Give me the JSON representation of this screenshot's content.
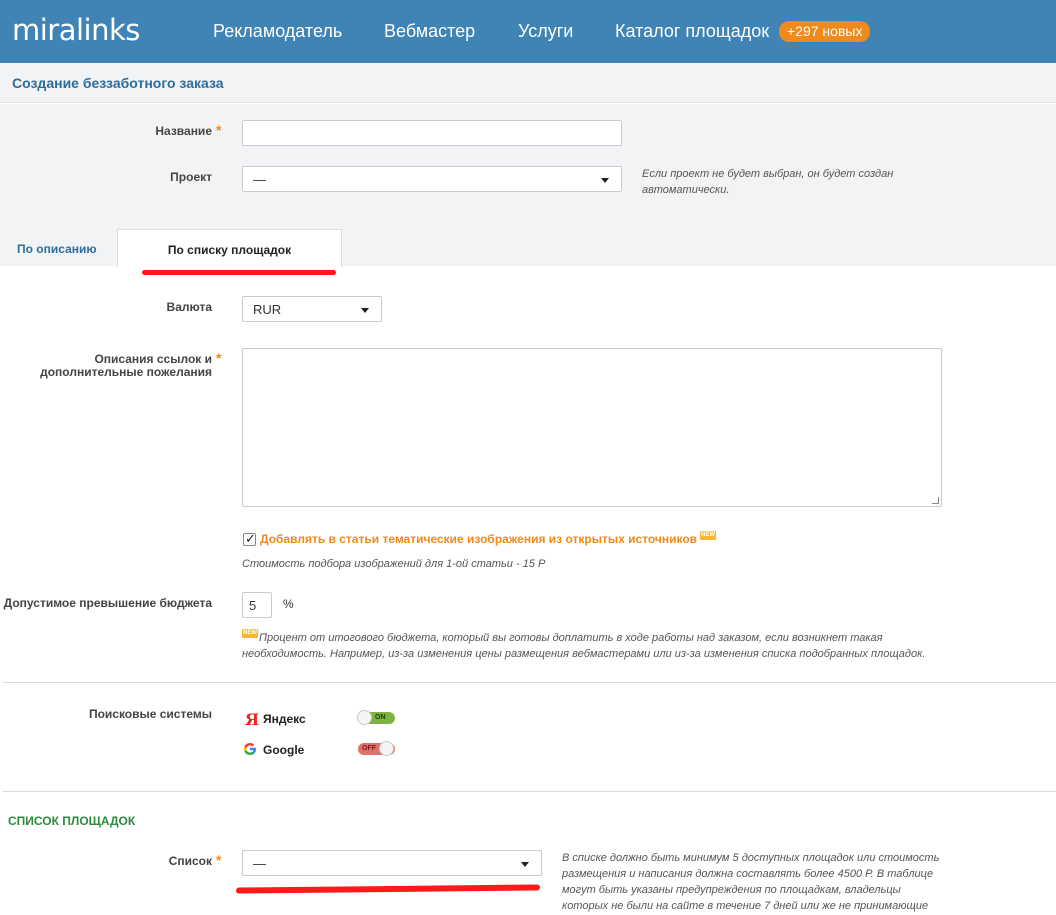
{
  "header": {
    "logo": "miralinks",
    "nav": [
      "Рекламодатель",
      "Вебмастер",
      "Услуги",
      "Каталог площадок"
    ],
    "badge": "+297 новых"
  },
  "page_title": "Создание беззаботного заказа",
  "form": {
    "name_label": "Название",
    "name_value": "",
    "project_label": "Проект",
    "project_value": "—",
    "project_hint": "Если проект не будет выбран, он будет создан автоматически."
  },
  "tabs": [
    "По описанию",
    "По списку площадок"
  ],
  "currency": {
    "label": "Валюта",
    "value": "RUR"
  },
  "links_description": {
    "label": "Описания ссылок и дополнительные пожелания",
    "value": ""
  },
  "images_option": {
    "label": "Добавлять в статьи тематические изображения из открытых источников",
    "checked": true,
    "hint": "Стоимость подбора изображений для 1-ой статьи - 15 Р",
    "new_badge": "NEW"
  },
  "budget": {
    "label": "Допустимое превышение бюджета",
    "value": "5",
    "unit": "%",
    "hint": "Процент от итогового бюджета, который вы готовы доплатить в ходе работы над заказом, если возникнет такая необходимость. Например, из-за изменения цены размещения вебмастерами или из-за изменения списка подобранных площадок."
  },
  "search_engines": {
    "label": "Поисковые системы",
    "items": [
      {
        "name": "Яндекс",
        "icon": "yandex-icon",
        "state": "ON",
        "color": "#7cb342"
      },
      {
        "name": "Google",
        "icon": "google-icon",
        "state": "OFF",
        "color": "#e0706b"
      }
    ]
  },
  "sites_section": {
    "title": "СПИСОК ПЛОЩАДОК",
    "list_label": "Список",
    "list_value": "—",
    "hint": "В списке должно быть минимум 5 доступных площадок или стоимость размещения и написания должна составлять более 4500 Р. В таблице могут быть указаны предупреждения по площадкам, владельцы которых не были на сайте в течение 7 дней или же не принимающие"
  },
  "colors": {
    "header_bg": "#3f84b5",
    "accent": "#f08a1c",
    "title": "#2d6d9b",
    "section": "#2e8b3e"
  }
}
